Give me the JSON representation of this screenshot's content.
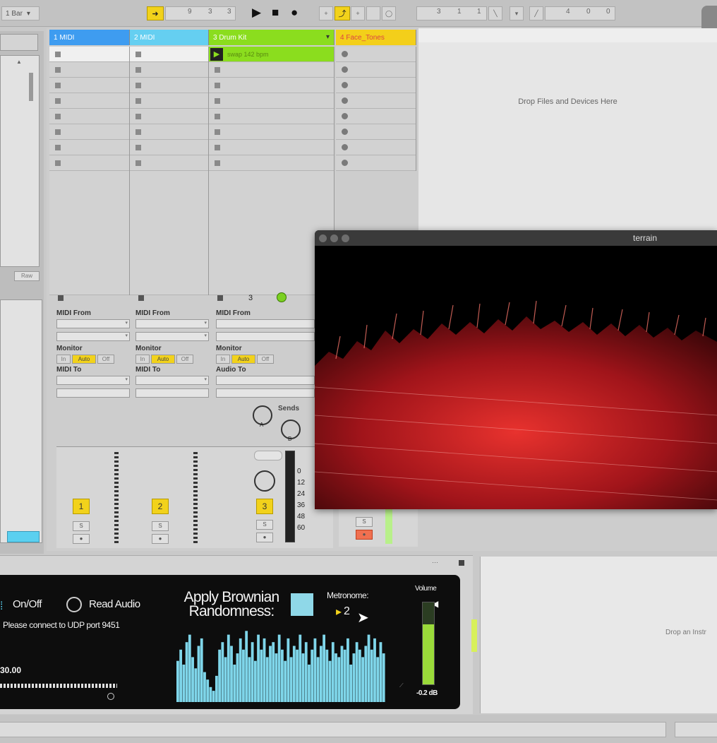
{
  "toolbar": {
    "quantization": "1 Bar",
    "tempo_digits": [
      "9",
      "3",
      "3"
    ],
    "loop_digits": [
      "3",
      "1",
      "1"
    ],
    "length_digits": [
      "4",
      "0",
      "0"
    ]
  },
  "tracks": [
    {
      "name": "1 MIDI",
      "color": "#3e9cf0",
      "number": "1",
      "from_label": "MIDI From",
      "monitor_label": "Monitor",
      "to_label": "MIDI To"
    },
    {
      "name": "2 MIDI",
      "color": "#65cff1",
      "number": "2",
      "from_label": "MIDI From",
      "monitor_label": "Monitor",
      "to_label": "MIDI To"
    },
    {
      "name": "3 Drum Kit",
      "color": "#8bdd1e",
      "number": "3",
      "from_label": "MIDI From",
      "monitor_label": "Monitor",
      "to_label": "Audio To"
    },
    {
      "name": "4 Face_Tones",
      "color": "#f3cf1a",
      "number": "4"
    }
  ],
  "monitor_options": [
    "In",
    "Auto",
    "Off"
  ],
  "clip": {
    "name": "swap 142 bpm"
  },
  "drum_extra": {
    "value": "3"
  },
  "sends": {
    "label": "Sends",
    "a": "A",
    "b": "B"
  },
  "db_scale": [
    "0",
    "12",
    "24",
    "36",
    "48",
    "60"
  ],
  "raw_label": "Raw",
  "drop_files_text": "Drop Files and Devices Here",
  "terrain": {
    "title": "terrain"
  },
  "device": {
    "onoff_label": "On/Off",
    "read_audio_label": "Read Audio",
    "udp_message": "Please connect to UDP port 9451",
    "value_readout": "30.00",
    "brownian_label_line1": "Apply Brownian",
    "brownian_label_line2": "Randomness:",
    "metronome_label": "Metronome:",
    "metronome_value": "2",
    "volume_label": "Volume",
    "volume_db": "-0.2 dB",
    "waveform": [
      0.55,
      0.7,
      0.5,
      0.8,
      0.9,
      0.6,
      0.45,
      0.75,
      0.85,
      0.4,
      0.3,
      0.2,
      0.15,
      0.35,
      0.7,
      0.8,
      0.6,
      0.9,
      0.75,
      0.5,
      0.65,
      0.85,
      0.7,
      0.95,
      0.6,
      0.8,
      0.55,
      0.9,
      0.7,
      0.85,
      0.6,
      0.75,
      0.8,
      0.65,
      0.9,
      0.7,
      0.55,
      0.85,
      0.6,
      0.75,
      0.7,
      0.9,
      0.65,
      0.8,
      0.5,
      0.7,
      0.85,
      0.6,
      0.75,
      0.9,
      0.7,
      0.55,
      0.8,
      0.65,
      0.6,
      0.75,
      0.7,
      0.85,
      0.5,
      0.65,
      0.8,
      0.7,
      0.6,
      0.75,
      0.9,
      0.7,
      0.85,
      0.6,
      0.8,
      0.65
    ]
  },
  "instrument_drop_text": "Drop an Instr"
}
